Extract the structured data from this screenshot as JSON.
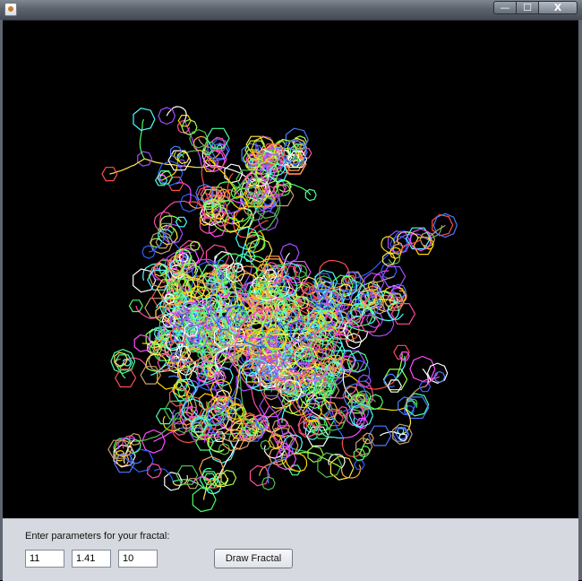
{
  "window": {
    "app_icon": "java-cup-icon",
    "controls": {
      "minimize": "—",
      "maximize": "☐",
      "close": "X"
    }
  },
  "canvas": {
    "background": "#000000",
    "palette": [
      "#ff4d4d",
      "#4dff6b",
      "#4d7bff",
      "#ffea4d",
      "#ff4dff",
      "#4dffff",
      "#ffa54d",
      "#a54dff",
      "#9cff4d",
      "#4dffa5",
      "#ff4da5",
      "#ffffff",
      "#c8a070",
      "#50c050",
      "#3060ff",
      "#ffd700"
    ]
  },
  "form": {
    "prompt": "Enter parameters for your fractal:",
    "fields": [
      {
        "value": "11"
      },
      {
        "value": "1.41"
      },
      {
        "value": "10"
      }
    ],
    "button_label": "Draw Fractal"
  }
}
